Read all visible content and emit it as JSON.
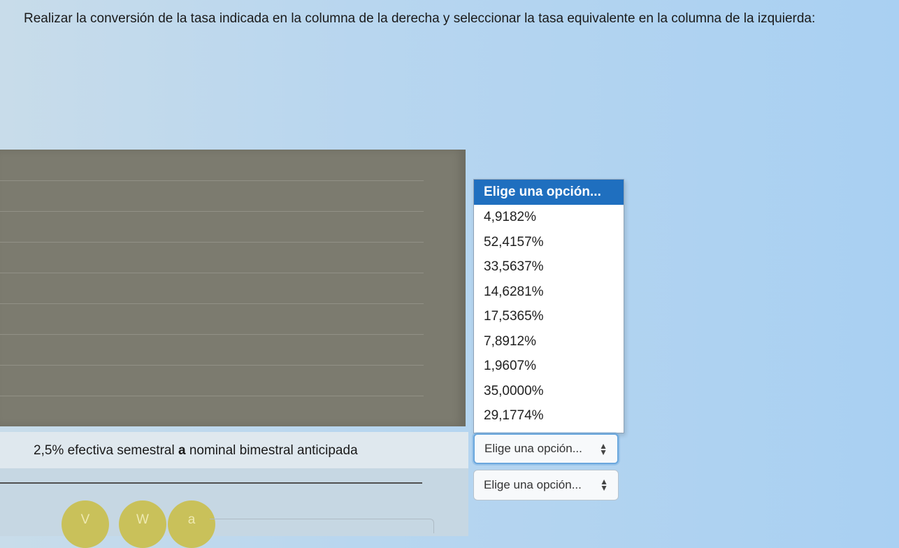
{
  "instructions": "Realizar la conversión de la tasa indicada en la columna de la derecha y seleccionar la tasa equivalente en la columna de la izquierda:",
  "dropdown": {
    "selected": "Elige una opción...",
    "options": [
      "4,9182%",
      "52,4157%",
      "33,5637%",
      "14,6281%",
      "17,5365%",
      "7,8912%",
      "1,9607%",
      "35,0000%",
      "29,1774%"
    ]
  },
  "question": {
    "prefix": "2,5% efectiva semestral ",
    "bold": "a",
    "suffix": " nominal bimestral anticipada"
  },
  "selects": [
    {
      "value": "Elige una opción..."
    },
    {
      "value": "Elige una opción..."
    }
  ],
  "nav_buttons": [
    "V",
    "W",
    "a"
  ],
  "colors": {
    "selected_bg": "#1f6fbf",
    "focus_ring": "#6aa7dd",
    "nav_button": "#c9c15a"
  }
}
